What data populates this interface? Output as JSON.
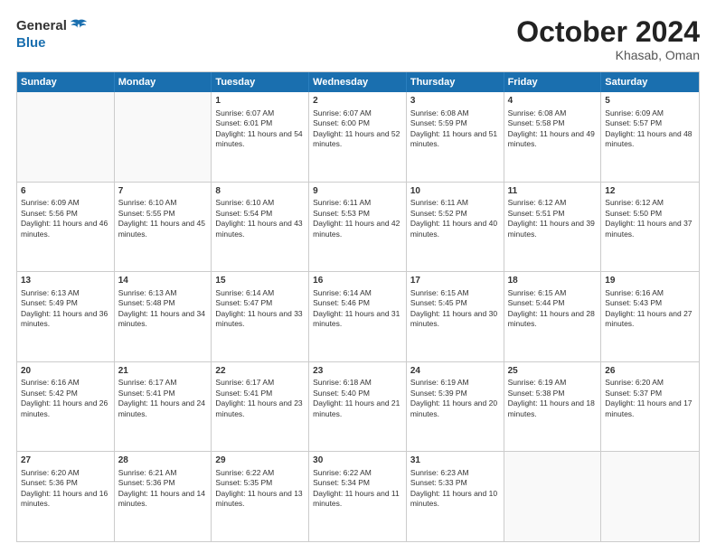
{
  "header": {
    "logo_general": "General",
    "logo_blue": "Blue",
    "month_title": "October 2024",
    "location": "Khasab, Oman"
  },
  "weekdays": [
    "Sunday",
    "Monday",
    "Tuesday",
    "Wednesday",
    "Thursday",
    "Friday",
    "Saturday"
  ],
  "rows": [
    [
      {
        "day": "",
        "sunrise": "",
        "sunset": "",
        "daylight": ""
      },
      {
        "day": "",
        "sunrise": "",
        "sunset": "",
        "daylight": ""
      },
      {
        "day": "1",
        "sunrise": "Sunrise: 6:07 AM",
        "sunset": "Sunset: 6:01 PM",
        "daylight": "Daylight: 11 hours and 54 minutes."
      },
      {
        "day": "2",
        "sunrise": "Sunrise: 6:07 AM",
        "sunset": "Sunset: 6:00 PM",
        "daylight": "Daylight: 11 hours and 52 minutes."
      },
      {
        "day": "3",
        "sunrise": "Sunrise: 6:08 AM",
        "sunset": "Sunset: 5:59 PM",
        "daylight": "Daylight: 11 hours and 51 minutes."
      },
      {
        "day": "4",
        "sunrise": "Sunrise: 6:08 AM",
        "sunset": "Sunset: 5:58 PM",
        "daylight": "Daylight: 11 hours and 49 minutes."
      },
      {
        "day": "5",
        "sunrise": "Sunrise: 6:09 AM",
        "sunset": "Sunset: 5:57 PM",
        "daylight": "Daylight: 11 hours and 48 minutes."
      }
    ],
    [
      {
        "day": "6",
        "sunrise": "Sunrise: 6:09 AM",
        "sunset": "Sunset: 5:56 PM",
        "daylight": "Daylight: 11 hours and 46 minutes."
      },
      {
        "day": "7",
        "sunrise": "Sunrise: 6:10 AM",
        "sunset": "Sunset: 5:55 PM",
        "daylight": "Daylight: 11 hours and 45 minutes."
      },
      {
        "day": "8",
        "sunrise": "Sunrise: 6:10 AM",
        "sunset": "Sunset: 5:54 PM",
        "daylight": "Daylight: 11 hours and 43 minutes."
      },
      {
        "day": "9",
        "sunrise": "Sunrise: 6:11 AM",
        "sunset": "Sunset: 5:53 PM",
        "daylight": "Daylight: 11 hours and 42 minutes."
      },
      {
        "day": "10",
        "sunrise": "Sunrise: 6:11 AM",
        "sunset": "Sunset: 5:52 PM",
        "daylight": "Daylight: 11 hours and 40 minutes."
      },
      {
        "day": "11",
        "sunrise": "Sunrise: 6:12 AM",
        "sunset": "Sunset: 5:51 PM",
        "daylight": "Daylight: 11 hours and 39 minutes."
      },
      {
        "day": "12",
        "sunrise": "Sunrise: 6:12 AM",
        "sunset": "Sunset: 5:50 PM",
        "daylight": "Daylight: 11 hours and 37 minutes."
      }
    ],
    [
      {
        "day": "13",
        "sunrise": "Sunrise: 6:13 AM",
        "sunset": "Sunset: 5:49 PM",
        "daylight": "Daylight: 11 hours and 36 minutes."
      },
      {
        "day": "14",
        "sunrise": "Sunrise: 6:13 AM",
        "sunset": "Sunset: 5:48 PM",
        "daylight": "Daylight: 11 hours and 34 minutes."
      },
      {
        "day": "15",
        "sunrise": "Sunrise: 6:14 AM",
        "sunset": "Sunset: 5:47 PM",
        "daylight": "Daylight: 11 hours and 33 minutes."
      },
      {
        "day": "16",
        "sunrise": "Sunrise: 6:14 AM",
        "sunset": "Sunset: 5:46 PM",
        "daylight": "Daylight: 11 hours and 31 minutes."
      },
      {
        "day": "17",
        "sunrise": "Sunrise: 6:15 AM",
        "sunset": "Sunset: 5:45 PM",
        "daylight": "Daylight: 11 hours and 30 minutes."
      },
      {
        "day": "18",
        "sunrise": "Sunrise: 6:15 AM",
        "sunset": "Sunset: 5:44 PM",
        "daylight": "Daylight: 11 hours and 28 minutes."
      },
      {
        "day": "19",
        "sunrise": "Sunrise: 6:16 AM",
        "sunset": "Sunset: 5:43 PM",
        "daylight": "Daylight: 11 hours and 27 minutes."
      }
    ],
    [
      {
        "day": "20",
        "sunrise": "Sunrise: 6:16 AM",
        "sunset": "Sunset: 5:42 PM",
        "daylight": "Daylight: 11 hours and 26 minutes."
      },
      {
        "day": "21",
        "sunrise": "Sunrise: 6:17 AM",
        "sunset": "Sunset: 5:41 PM",
        "daylight": "Daylight: 11 hours and 24 minutes."
      },
      {
        "day": "22",
        "sunrise": "Sunrise: 6:17 AM",
        "sunset": "Sunset: 5:41 PM",
        "daylight": "Daylight: 11 hours and 23 minutes."
      },
      {
        "day": "23",
        "sunrise": "Sunrise: 6:18 AM",
        "sunset": "Sunset: 5:40 PM",
        "daylight": "Daylight: 11 hours and 21 minutes."
      },
      {
        "day": "24",
        "sunrise": "Sunrise: 6:19 AM",
        "sunset": "Sunset: 5:39 PM",
        "daylight": "Daylight: 11 hours and 20 minutes."
      },
      {
        "day": "25",
        "sunrise": "Sunrise: 6:19 AM",
        "sunset": "Sunset: 5:38 PM",
        "daylight": "Daylight: 11 hours and 18 minutes."
      },
      {
        "day": "26",
        "sunrise": "Sunrise: 6:20 AM",
        "sunset": "Sunset: 5:37 PM",
        "daylight": "Daylight: 11 hours and 17 minutes."
      }
    ],
    [
      {
        "day": "27",
        "sunrise": "Sunrise: 6:20 AM",
        "sunset": "Sunset: 5:36 PM",
        "daylight": "Daylight: 11 hours and 16 minutes."
      },
      {
        "day": "28",
        "sunrise": "Sunrise: 6:21 AM",
        "sunset": "Sunset: 5:36 PM",
        "daylight": "Daylight: 11 hours and 14 minutes."
      },
      {
        "day": "29",
        "sunrise": "Sunrise: 6:22 AM",
        "sunset": "Sunset: 5:35 PM",
        "daylight": "Daylight: 11 hours and 13 minutes."
      },
      {
        "day": "30",
        "sunrise": "Sunrise: 6:22 AM",
        "sunset": "Sunset: 5:34 PM",
        "daylight": "Daylight: 11 hours and 11 minutes."
      },
      {
        "day": "31",
        "sunrise": "Sunrise: 6:23 AM",
        "sunset": "Sunset: 5:33 PM",
        "daylight": "Daylight: 11 hours and 10 minutes."
      },
      {
        "day": "",
        "sunrise": "",
        "sunset": "",
        "daylight": ""
      },
      {
        "day": "",
        "sunrise": "",
        "sunset": "",
        "daylight": ""
      }
    ]
  ]
}
